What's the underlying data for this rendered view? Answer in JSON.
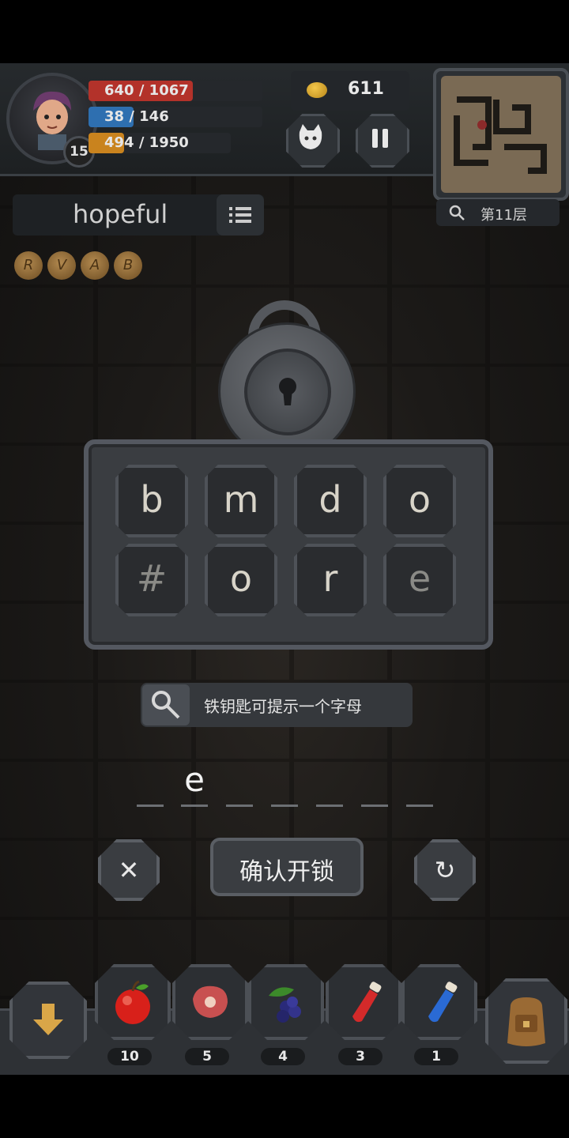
{
  "player": {
    "level": "15",
    "hp": "640 / 1067",
    "hp_fraction": 0.6,
    "mp": "38 / 146",
    "mp_fraction": 0.26,
    "exp": "494 / 1950",
    "exp_fraction": 0.25,
    "gold": "611"
  },
  "floor_label": "第11层",
  "puzzle": {
    "clue_word": "hopeful",
    "rune_letters": [
      "R",
      "V",
      "A",
      "B"
    ],
    "keys_row1": [
      "b",
      "m",
      "d",
      "o"
    ],
    "keys_row2": [
      "#",
      "o",
      "r",
      "e"
    ],
    "hint_text": "铁钥匙可提示一个字母",
    "answer_letters": [
      "",
      "e",
      "",
      "",
      "",
      "",
      ""
    ],
    "confirm_label": "确认开锁",
    "cancel_symbol": "✕",
    "reset_symbol": "↻"
  },
  "inventory": [
    {
      "name": "apple",
      "count": "10",
      "icon": "apple-icon"
    },
    {
      "name": "meat",
      "count": "5",
      "icon": "meat-icon"
    },
    {
      "name": "berries",
      "count": "4",
      "icon": "berries-icon"
    },
    {
      "name": "red-potion",
      "count": "3",
      "icon": "red-potion-icon"
    },
    {
      "name": "blue-potion",
      "count": "1",
      "icon": "blue-potion-icon"
    }
  ],
  "colors": {
    "hp": "#c0392b",
    "mp": "#2e6fb0",
    "exp": "#c9831e",
    "gold": "#f4c74a"
  }
}
